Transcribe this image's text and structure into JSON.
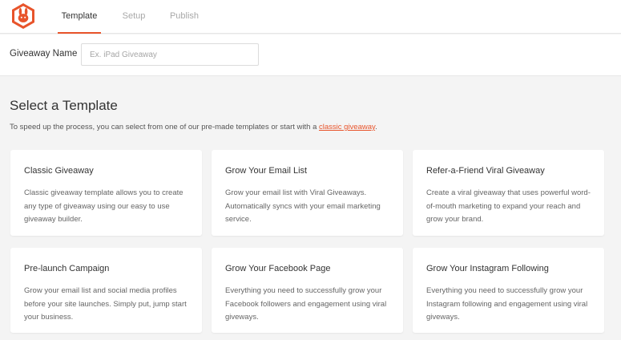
{
  "header": {
    "tabs": [
      {
        "label": "Template",
        "active": true
      },
      {
        "label": "Setup",
        "active": false
      },
      {
        "label": "Publish",
        "active": false
      }
    ],
    "logo_icon": "rabbit-logo-icon",
    "accent_color": "#e8542b"
  },
  "giveaway_name": {
    "label": "Giveaway Name",
    "value": "",
    "placeholder": "Ex. iPad Giveaway"
  },
  "main": {
    "heading": "Select a Template",
    "intro_text": "To speed up the process, you can select from one of our pre-made templates or start with a",
    "intro_link": "classic giveaway",
    "intro_end": "."
  },
  "templates": [
    {
      "title": "Classic Giveaway",
      "description": "Classic giveaway template allows you to create any type of giveaway using our easy to use giveaway builder."
    },
    {
      "title": "Grow Your Email List",
      "description": "Grow your email list with Viral Giveaways. Automatically syncs with your email marketing service."
    },
    {
      "title": "Refer-a-Friend Viral Giveaway",
      "description": "Create a viral giveaway that uses powerful word-of-mouth marketing to expand your reach and grow your brand."
    },
    {
      "title": "Pre-launch Campaign",
      "description": "Grow your email list and social media profiles before your site launches. Simply put, jump start your business."
    },
    {
      "title": "Grow Your Facebook Page",
      "description": "Everything you need to successfully grow your Facebook followers and engagement using viral giveways."
    },
    {
      "title": "Grow Your Instagram Following",
      "description": "Everything you need to successfully grow your Instagram following and engagement using viral giveways."
    }
  ]
}
